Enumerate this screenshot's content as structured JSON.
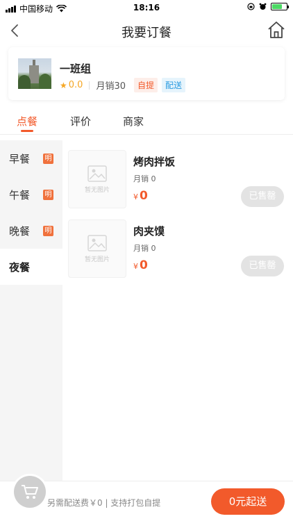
{
  "status_bar": {
    "carrier": "中国移动",
    "time": "18:16"
  },
  "nav": {
    "title": "我要订餐",
    "back_icon": "chevron-left-icon",
    "home_icon": "home-icon"
  },
  "shop": {
    "name": "一班组",
    "rating": "0.0",
    "monthly_sales": "月销30",
    "tags": [
      "自提",
      "配送"
    ]
  },
  "tabs": [
    "点餐",
    "评价",
    "商家"
  ],
  "active_tab": "点餐",
  "categories": [
    {
      "label": "早餐",
      "badge": "明"
    },
    {
      "label": "午餐",
      "badge": "明"
    },
    {
      "label": "晚餐",
      "badge": "明"
    },
    {
      "label": "夜餐",
      "badge": ""
    }
  ],
  "active_category": "夜餐",
  "products": [
    {
      "name": "烤肉拌饭",
      "sales": "月销 0",
      "currency": "¥",
      "price": "0",
      "image_placeholder": "暂无图片",
      "button": "已售罄"
    },
    {
      "name": "肉夹馍",
      "sales": "月销 0",
      "currency": "¥",
      "price": "0",
      "image_placeholder": "暂无图片",
      "button": "已售罄"
    }
  ],
  "bottom": {
    "info": "另需配送费￥0 | 支持打包自提",
    "checkout": "0元起送",
    "cart_icon": "cart-icon"
  },
  "colors": {
    "accent": "#f25a2b",
    "delivery_tag": "#2a9be0",
    "sold_out_button": "#e3e3e3",
    "sidebar_bg": "#f5f5f5"
  }
}
